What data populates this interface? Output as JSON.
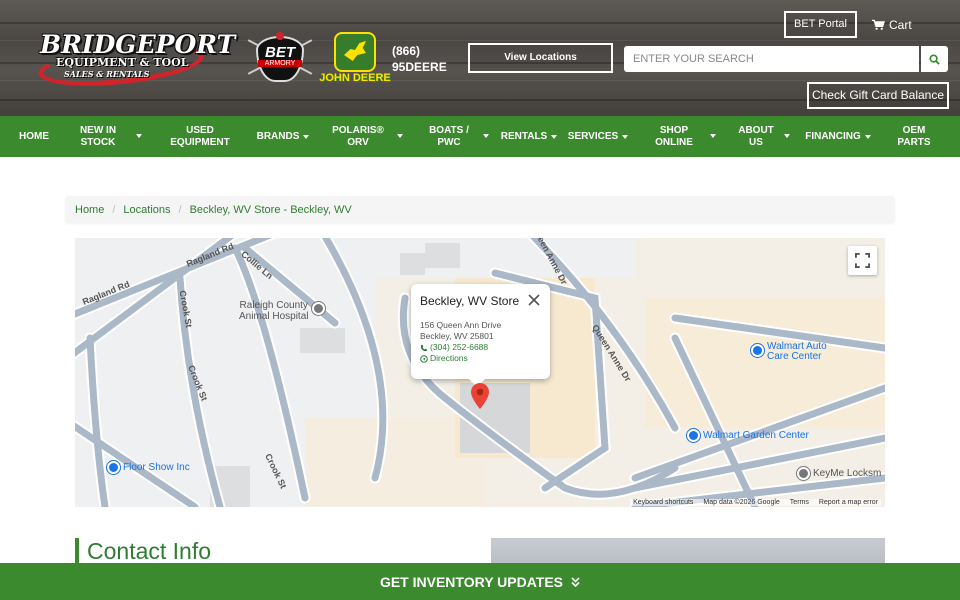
{
  "header": {
    "logo": {
      "brand": "BRIDGEPORT",
      "line1": "EQUIPMENT & TOOL",
      "line2": "SALES & RENTALS"
    },
    "bet_logo": {
      "text": "BET",
      "sub": "ARMORY"
    },
    "jd_logo": {
      "text": "JOHN DEERE"
    },
    "phone_line1": "(866)",
    "phone_line2": "95DEERE",
    "view_locations": "View Locations",
    "bet_portal": "BET Portal",
    "cart": "Cart",
    "search_placeholder": "ENTER YOUR SEARCH",
    "gift_card": "Check Gift Card Balance"
  },
  "nav": [
    {
      "label": "HOME"
    },
    {
      "label": "NEW IN STOCK"
    },
    {
      "label": "USED EQUIPMENT"
    },
    {
      "label": "BRANDS"
    },
    {
      "label": "POLARIS® ORV"
    },
    {
      "label": "BOATS / PWC"
    },
    {
      "label": "RENTALS"
    },
    {
      "label": "SERVICES"
    },
    {
      "label": "SHOP ONLINE"
    },
    {
      "label": "ABOUT US"
    },
    {
      "label": "FINANCING"
    },
    {
      "label": "OEM PARTS"
    }
  ],
  "breadcrumb": [
    "Home",
    "Locations",
    "Beckley, WV Store - Beckley, WV"
  ],
  "map": {
    "roads": [
      "Ragland Rd",
      "Ragland Rd",
      "Collie Ln",
      "Crook St",
      "Crook St",
      "Crook St",
      "Queen Anne Dr",
      "Queen Anne Dr"
    ],
    "places": [
      "Raleigh County",
      "Animal Hospital"
    ],
    "pois": [
      "Walmart Auto",
      "Care Center",
      "Walmart Garden Center",
      "Floor Show Inc",
      "KeyMe Locksm"
    ],
    "infowindow": {
      "title": "Beckley, WV Store",
      "address1": "156 Queen Ann Drive",
      "address2": "Beckley, WV 25801",
      "phone": "(304) 252-6688",
      "directions": "Directions"
    },
    "footer": [
      "Keyboard shortcuts",
      "Map data ©2026 Google",
      "Terms",
      "Report a map error"
    ]
  },
  "contact_title": "Contact Info",
  "inventory_bar": "GET INVENTORY UPDATES",
  "colors": {
    "green": "#3c8a2e",
    "green_text": "#2e7d32",
    "red": "#d2232a",
    "jd_yellow": "#fde100"
  }
}
